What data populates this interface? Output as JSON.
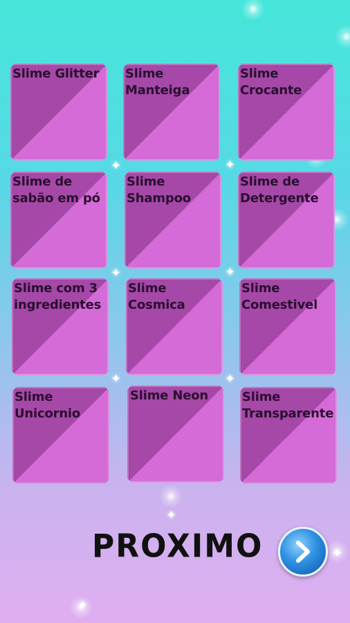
{
  "tiles": [
    {
      "label": "Slime Glitter"
    },
    {
      "label": "Slime Manteiga"
    },
    {
      "label": "Slime Crocante"
    },
    {
      "label": "Slime de sabão em pó"
    },
    {
      "label": "Slime Shampoo"
    },
    {
      "label": "Slime de Detergente"
    },
    {
      "label": "Slime com 3 ingredientes"
    },
    {
      "label": "Slime Cosmica"
    },
    {
      "label": "Slime Comestivel"
    },
    {
      "label": "Slime Unicornio"
    },
    {
      "label": "Slime Neon"
    },
    {
      "label": "Slime Transparente"
    }
  ],
  "footer": {
    "next_label": "PROXIMO",
    "next_icon": "chevron-right-icon"
  },
  "colors": {
    "tile_dark": "#a548a8",
    "tile_light": "#d46bd6",
    "next_button": "#2e8fe0"
  }
}
